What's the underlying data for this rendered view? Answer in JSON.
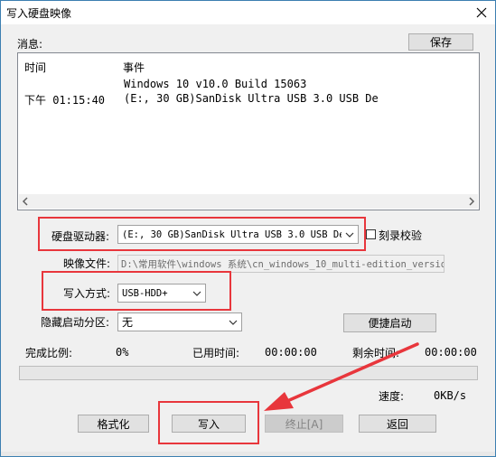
{
  "window": {
    "title": "写入硬盘映像"
  },
  "messages": {
    "label": "消息:",
    "save_label": "保存",
    "col_time": "时间",
    "col_event": "事件",
    "rows": [
      {
        "time": "",
        "event": "Windows 10 v10.0 Build 15063"
      },
      {
        "time": "下午 01:15:40",
        "event": "(E:, 30 GB)SanDisk Ultra USB 3.0 USB De"
      }
    ]
  },
  "form": {
    "drive_label": "硬盘驱动器:",
    "drive_value": "(E:, 30 GB)SanDisk Ultra USB 3.0 USB De",
    "verify_label": "刻录校验",
    "image_label": "映像文件:",
    "image_value": "D:\\常用软件\\windows 系统\\cn_windows_10_multi-edition_versio",
    "method_label": "写入方式:",
    "method_value": "USB-HDD+",
    "hidden_label": "隐藏启动分区:",
    "hidden_value": "无",
    "quickboot_label": "便捷启动"
  },
  "status": {
    "progress_label": "完成比例:",
    "progress_value": "0%",
    "progress_fraction": 0,
    "elapsed_label": "已用时间:",
    "elapsed_value": "00:00:00",
    "remaining_label": "剩余时间:",
    "remaining_value": "00:00:00",
    "speed_label": "速度:",
    "speed_value": "0KB/s"
  },
  "buttons": {
    "format": "格式化",
    "write": "写入",
    "stop": "终止[A]",
    "back": "返回"
  },
  "colors": {
    "highlight": "#e8363c",
    "accent": "#0078d7"
  }
}
